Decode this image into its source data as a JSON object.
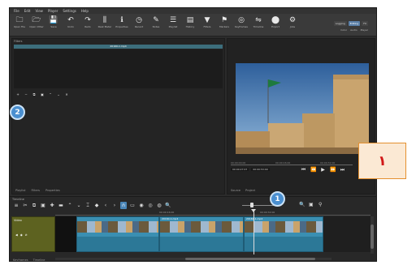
{
  "menu": [
    "File",
    "Edit",
    "View",
    "Player",
    "Settings",
    "Help"
  ],
  "toolbar": [
    {
      "icon": "open-file-icon",
      "glyph": "🗀",
      "label": "Open File"
    },
    {
      "icon": "open-other-icon",
      "glyph": "🗁",
      "label": "Open Other"
    },
    {
      "icon": "save-icon",
      "glyph": "💾",
      "label": "Save"
    },
    {
      "icon": "undo-icon",
      "glyph": "↶",
      "label": "Undo"
    },
    {
      "icon": "redo-icon",
      "glyph": "↷",
      "label": "Redo"
    },
    {
      "icon": "peak-meter-icon",
      "glyph": "⫼",
      "label": "Peak Meter"
    },
    {
      "icon": "properties-icon",
      "glyph": "ℹ",
      "label": "Properties"
    },
    {
      "icon": "recent-icon",
      "glyph": "◷",
      "label": "Recent"
    },
    {
      "icon": "notes-icon",
      "glyph": "✎",
      "label": "Notes"
    },
    {
      "icon": "playlist-icon",
      "glyph": "☰",
      "label": "Playlist"
    },
    {
      "icon": "history-icon",
      "glyph": "▤",
      "label": "History"
    },
    {
      "icon": "filters-icon",
      "glyph": "▼",
      "label": "Filters"
    },
    {
      "icon": "markers-icon",
      "glyph": "⚑",
      "label": "Markers"
    },
    {
      "icon": "keyframes-icon",
      "glyph": "◎",
      "label": "Keyframes"
    },
    {
      "icon": "timeline-icon",
      "glyph": "⇋",
      "label": "Timeline"
    },
    {
      "icon": "export-icon",
      "glyph": "⬤",
      "label": "Export"
    },
    {
      "icon": "jobs-icon",
      "glyph": "⚙",
      "label": "Jobs"
    }
  ],
  "layout_modes": [
    "Logging",
    "Editing",
    "FX"
  ],
  "layout_active": "Editing",
  "layout_sub": [
    "Color",
    "Audio",
    "Player"
  ],
  "filters_panel": {
    "title": "Filters",
    "clip_name": "20160-1.mp4",
    "tabs": [
      "Playlist",
      "Filters",
      "Properties"
    ]
  },
  "player": {
    "timecode_current": "00:00:27:07",
    "timecode_total": "00:00:53:09",
    "ruler_marks": [
      "00:00:00:00",
      "00:00:16:00",
      "00:00:32:00"
    ],
    "tabs": [
      "Source",
      "Project"
    ]
  },
  "timeline": {
    "title": "Timeline",
    "track_name": "Video",
    "track_controls": [
      "◀",
      "◉",
      "⊘"
    ],
    "ruler_marks": [
      "00:00:16:00",
      "00:00:32:00"
    ],
    "tabs": [
      "Keyframes",
      "Timeline"
    ],
    "clips": [
      {
        "name": ""
      },
      {
        "name": "20160-1.mp4"
      },
      {
        "name": "20160-1.mp4"
      },
      {
        "name": "20160-1.mp4"
      }
    ]
  },
  "callouts": [
    "1",
    "2"
  ],
  "box_label": "١"
}
